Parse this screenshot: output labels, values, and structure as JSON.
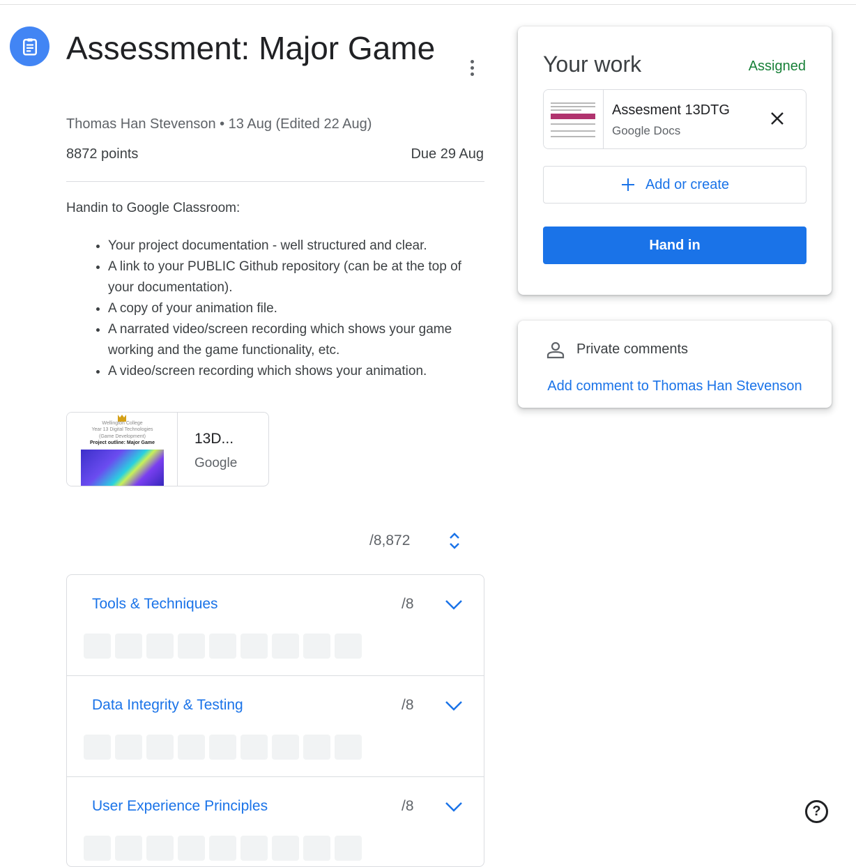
{
  "assignment": {
    "icon": "assignment-icon",
    "title": "Assessment: Major Game",
    "meta": "Thomas Han Stevenson • 13 Aug (Edited 22 Aug)",
    "points": "8872 points",
    "due": "Due 29 Aug",
    "instructions_intro": "Handin to Google Classroom:",
    "instructions_items": [
      "Your project documentation - well structured and clear.",
      "A link to your PUBLIC Github repository (can be at the top of your documentation).",
      "A copy of your animation file.",
      "A narrated video/screen recording which shows your game working and the game functionality, etc.",
      "A video/screen recording which shows your animation."
    ]
  },
  "attachment": {
    "title": "13D...",
    "type": "Google",
    "thumb_lines": [
      "Wellington College",
      "Year 13 Digital Technologies",
      "(Game Development)",
      "Project outline: Major Game"
    ]
  },
  "grade": {
    "total": "/8,872"
  },
  "rubric": {
    "criteria": [
      {
        "title": "Tools & Techniques",
        "score": "/8"
      },
      {
        "title": "Data Integrity & Testing",
        "score": "/8"
      },
      {
        "title": "User Experience Principles",
        "score": "/8"
      }
    ]
  },
  "your_work": {
    "title": "Your work",
    "status": "Assigned",
    "status_color": "#188038",
    "doc_title": "Assesment 13DTG",
    "doc_type": "Google Docs",
    "add_label": "Add or create",
    "hand_in_label": "Hand in"
  },
  "comments": {
    "title": "Private comments",
    "add_label": "Add comment to Thomas Han Stevenson"
  },
  "colors": {
    "accent": "#1a73e8",
    "assign_icon_bg": "#4285f4"
  }
}
